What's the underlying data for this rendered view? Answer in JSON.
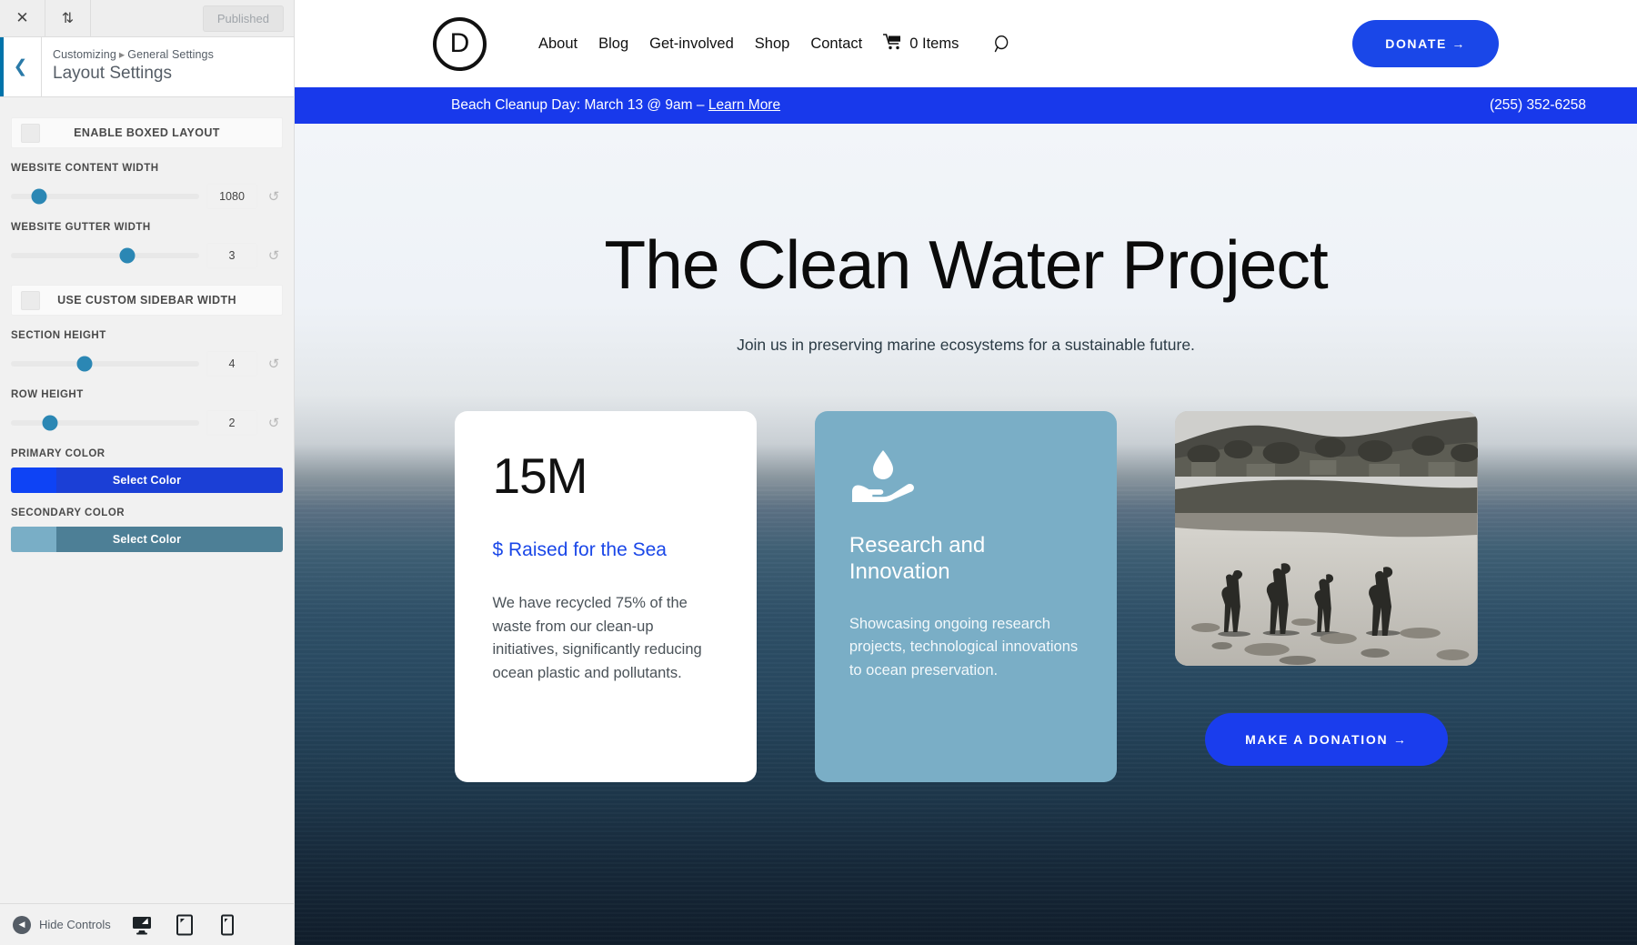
{
  "customizer": {
    "topbar": {
      "close_icon": "close-icon",
      "devices_icon": "updown-arrows-icon",
      "published_label": "Published"
    },
    "header": {
      "back_icon": "chevron-left-icon",
      "breadcrumb_root": "Customizing",
      "breadcrumb_sep": "▸",
      "breadcrumb_section": "General Settings",
      "title": "Layout Settings"
    },
    "controls": [
      {
        "type": "checkbox",
        "label": "ENABLE BOXED LAYOUT",
        "checked": false
      },
      {
        "type": "slider",
        "label": "WEBSITE CONTENT WIDTH",
        "value": "1080",
        "pos_pct": 15
      },
      {
        "type": "slider",
        "label": "WEBSITE GUTTER WIDTH",
        "value": "3",
        "pos_pct": 62
      },
      {
        "type": "checkbox",
        "label": "USE CUSTOM SIDEBAR WIDTH",
        "checked": false
      },
      {
        "type": "slider",
        "label": "SECTION HEIGHT",
        "value": "4",
        "pos_pct": 39
      },
      {
        "type": "slider",
        "label": "ROW HEIGHT",
        "value": "2",
        "pos_pct": 21
      }
    ],
    "reset_icon": "reset-arrow-icon",
    "colors": [
      {
        "label": "PRIMARY COLOR",
        "button_label": "Select Color",
        "swatch": "#0e43f5",
        "fill": "#1b3fd6"
      },
      {
        "label": "SECONDARY COLOR",
        "button_label": "Select Color",
        "swatch": "#79aec6",
        "fill": "#4d7f96"
      }
    ],
    "footer": {
      "hide_label": "Hide Controls",
      "hide_icon": "caret-left-circle-icon",
      "devices": [
        {
          "name": "desktop-icon",
          "active": true
        },
        {
          "name": "tablet-icon",
          "active": false
        },
        {
          "name": "mobile-icon",
          "active": false
        }
      ]
    }
  },
  "site": {
    "logo_letter": "D",
    "nav": [
      {
        "label": "About"
      },
      {
        "label": "Blog"
      },
      {
        "label": "Get-involved"
      },
      {
        "label": "Shop"
      },
      {
        "label": "Contact"
      }
    ],
    "cart_label": "0 Items",
    "cart_icon": "shopping-cart-icon",
    "search_icon": "search-icon",
    "donate_label": "DONATE →",
    "announcement": {
      "text": "Beach Cleanup Day: March 13 @ 9am – ",
      "link_label": "Learn More",
      "phone": "(255) 352-6258"
    },
    "hero": {
      "title": "The Clean Water Project",
      "subtitle": "Join us in preserving marine ecosystems for a sustainable future."
    },
    "cards": {
      "stat": {
        "number": "15M",
        "label": "$ Raised for the Sea",
        "body": "We have recycled 75% of the waste from our clean-up initiatives, significantly reducing ocean plastic and pollutants."
      },
      "feature": {
        "icon": "water-drop-in-hand-icon",
        "title": "Research and Innovation",
        "body": "Showcasing ongoing research projects, technological innovations to ocean preservation."
      },
      "photo": {
        "alt": "people-on-beach-photo",
        "button_label": "MAKE A DONATION →"
      }
    }
  }
}
